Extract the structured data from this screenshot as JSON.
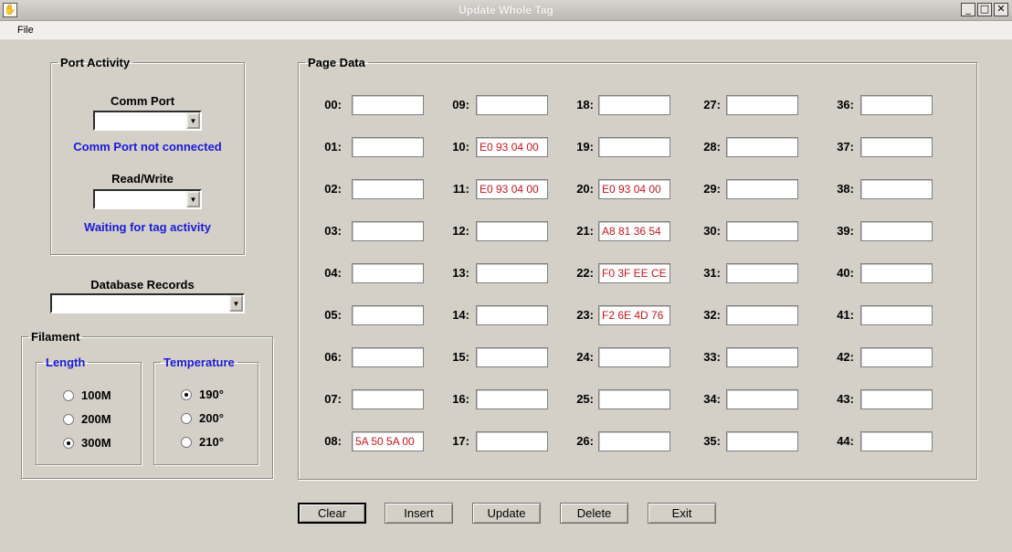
{
  "window": {
    "title": "Update Whole Tag",
    "minimize_icon": "minimize-icon",
    "maximize_icon": "maximize-icon",
    "close_icon": "close-icon"
  },
  "menu": {
    "file": "File"
  },
  "port_activity": {
    "legend": "Port Activity",
    "comm_port_label": "Comm Port",
    "comm_port_value": "",
    "comm_status": "Comm Port not connected",
    "read_write_label": "Read/Write",
    "read_write_value": "",
    "tag_status": "Waiting for tag activity"
  },
  "database": {
    "label": "Database Records",
    "value": ""
  },
  "filament": {
    "legend": "Filament",
    "length": {
      "legend": "Length",
      "options": [
        {
          "label": "100M",
          "checked": false
        },
        {
          "label": "200M",
          "checked": false
        },
        {
          "label": "300M",
          "checked": true
        }
      ]
    },
    "temperature": {
      "legend": "Temperature",
      "options": [
        {
          "label": "190°",
          "checked": true
        },
        {
          "label": "200°",
          "checked": false
        },
        {
          "label": "210°",
          "checked": false
        }
      ]
    }
  },
  "page_data": {
    "legend": "Page Data",
    "pages": [
      {
        "label": "00:",
        "value": ""
      },
      {
        "label": "01:",
        "value": ""
      },
      {
        "label": "02:",
        "value": ""
      },
      {
        "label": "03:",
        "value": ""
      },
      {
        "label": "04:",
        "value": ""
      },
      {
        "label": "05:",
        "value": ""
      },
      {
        "label": "06:",
        "value": ""
      },
      {
        "label": "07:",
        "value": ""
      },
      {
        "label": "08:",
        "value": "5A 50 5A 00"
      },
      {
        "label": "09:",
        "value": ""
      },
      {
        "label": "10:",
        "value": "E0 93 04 00"
      },
      {
        "label": "11:",
        "value": "E0 93 04 00"
      },
      {
        "label": "12:",
        "value": ""
      },
      {
        "label": "13:",
        "value": ""
      },
      {
        "label": "14:",
        "value": ""
      },
      {
        "label": "15:",
        "value": ""
      },
      {
        "label": "16:",
        "value": ""
      },
      {
        "label": "17:",
        "value": ""
      },
      {
        "label": "18:",
        "value": ""
      },
      {
        "label": "19:",
        "value": ""
      },
      {
        "label": "20:",
        "value": "E0 93 04 00"
      },
      {
        "label": "21:",
        "value": "A8 81 36 54"
      },
      {
        "label": "22:",
        "value": "F0 3F EE CE"
      },
      {
        "label": "23:",
        "value": "F2 6E 4D 76"
      },
      {
        "label": "24:",
        "value": ""
      },
      {
        "label": "25:",
        "value": ""
      },
      {
        "label": "26:",
        "value": ""
      },
      {
        "label": "27:",
        "value": ""
      },
      {
        "label": "28:",
        "value": ""
      },
      {
        "label": "29:",
        "value": ""
      },
      {
        "label": "30:",
        "value": ""
      },
      {
        "label": "31:",
        "value": ""
      },
      {
        "label": "32:",
        "value": ""
      },
      {
        "label": "33:",
        "value": ""
      },
      {
        "label": "34:",
        "value": ""
      },
      {
        "label": "35:",
        "value": ""
      },
      {
        "label": "36:",
        "value": ""
      },
      {
        "label": "37:",
        "value": ""
      },
      {
        "label": "38:",
        "value": ""
      },
      {
        "label": "39:",
        "value": ""
      },
      {
        "label": "40:",
        "value": ""
      },
      {
        "label": "41:",
        "value": ""
      },
      {
        "label": "42:",
        "value": ""
      },
      {
        "label": "43:",
        "value": ""
      },
      {
        "label": "44:",
        "value": ""
      }
    ]
  },
  "buttons": {
    "clear": "Clear",
    "insert": "Insert",
    "update": "Update",
    "delete": "Delete",
    "exit": "Exit"
  },
  "colors": {
    "window_bg": "#d4d0c8",
    "status_text": "#1a1ad6",
    "page_value_text": "#c8161d"
  }
}
